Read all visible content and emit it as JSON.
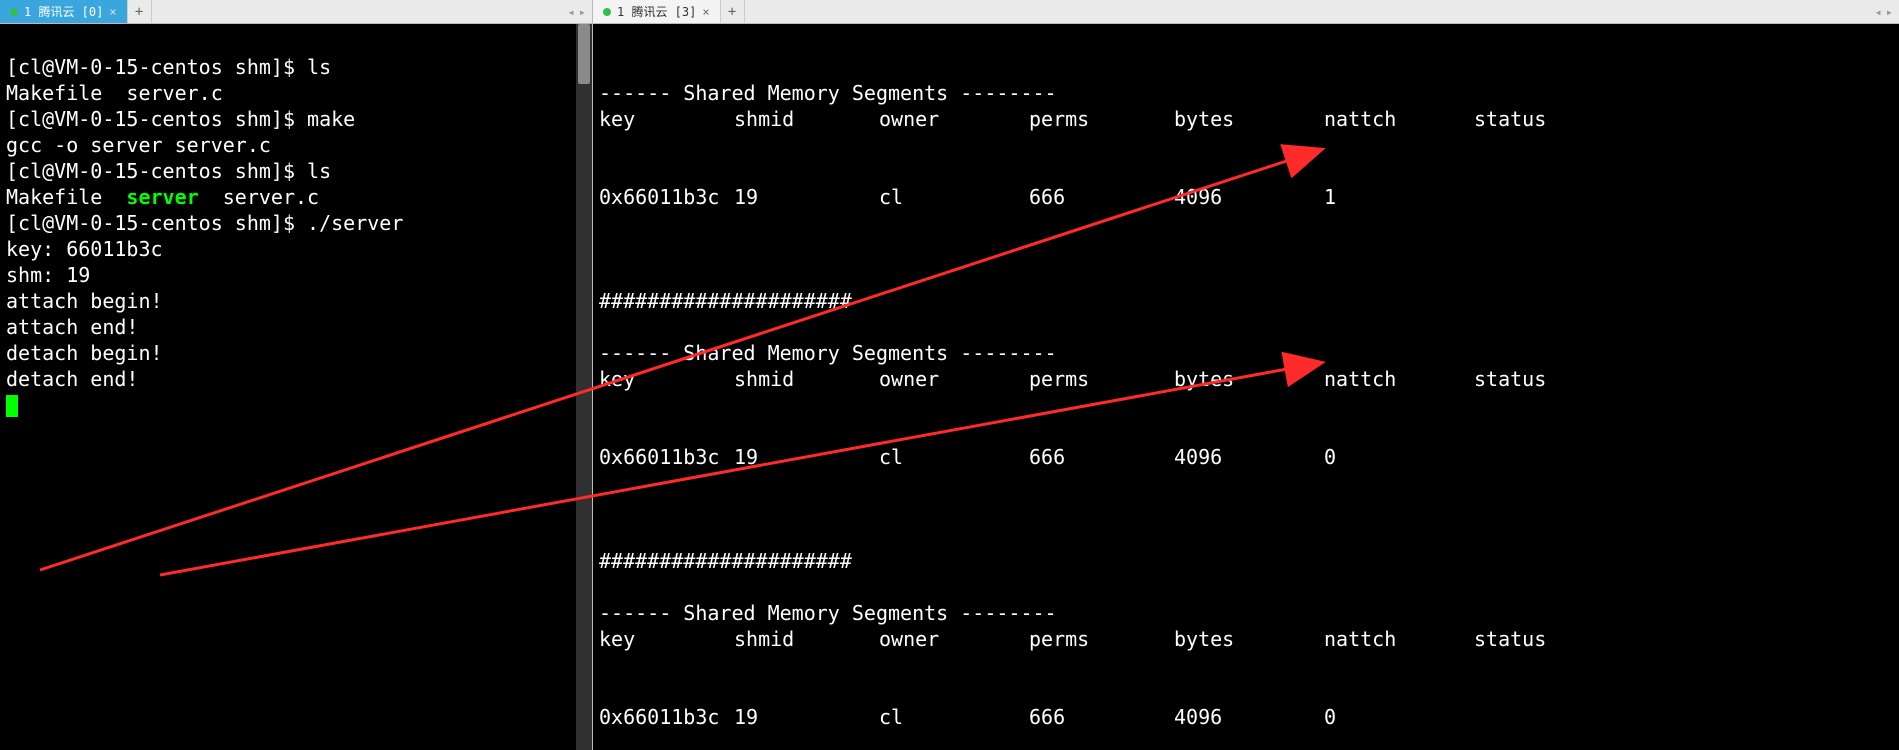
{
  "tabs": {
    "left": {
      "label": "1 腾讯云 [0]"
    },
    "right": {
      "label": "1 腾讯云 [3]"
    }
  },
  "newtab_glyph": "+",
  "arrow_left": "◂",
  "arrow_right": "▸",
  "tab_close": "×",
  "left_terminal": {
    "prompt": "[cl@VM-0-15-centos shm]$ ",
    "cmd_ls1": "ls",
    "out_ls1": "Makefile  server.c",
    "cmd_make": "make",
    "out_make": "gcc -o server server.c",
    "cmd_ls2": "ls",
    "out_ls2_a": "Makefile  ",
    "out_ls2_server": "server",
    "out_ls2_b": "  server.c",
    "cmd_run": "./server",
    "lines": [
      "key: 66011b3c",
      "shm: 19",
      "attach begin!",
      "attach end!",
      "detach begin!",
      "detach end!"
    ]
  },
  "right_terminal": {
    "seg_header_dashL": "------ ",
    "seg_header_text": "Shared Memory Segments",
    "seg_header_dashR": " --------",
    "columns": {
      "key": "key",
      "shmid": "shmid",
      "owner": "owner",
      "perms": "perms",
      "bytes": "bytes",
      "nattch": "nattch",
      "status": "status"
    },
    "divider": "#####################",
    "rows": [
      {
        "key": "0x66011b3c",
        "shmid": "19",
        "owner": "cl",
        "perms": "666",
        "bytes": "4096",
        "nattch": "1",
        "status": ""
      },
      {
        "key": "0x66011b3c",
        "shmid": "19",
        "owner": "cl",
        "perms": "666",
        "bytes": "4096",
        "nattch": "0",
        "status": ""
      },
      {
        "key": "0x66011b3c",
        "shmid": "19",
        "owner": "cl",
        "perms": "666",
        "bytes": "4096",
        "nattch": "0",
        "status": ""
      }
    ]
  },
  "colors": {
    "terminal_bg": "#000000",
    "terminal_fg": "#ffffff",
    "exec_green": "#00ff00",
    "tab_active": "#3ba6dd",
    "arrow": "#ff2a2a"
  }
}
